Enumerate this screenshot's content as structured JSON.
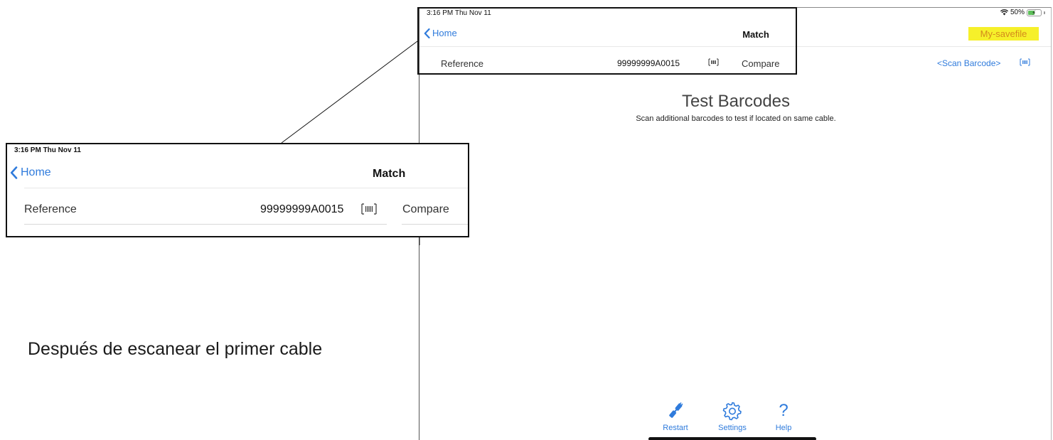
{
  "status_bar": {
    "time_date": "3:16 PM  Thu Nov 11",
    "battery": "50%",
    "battery_level": 0.5
  },
  "nav": {
    "back_label": "Home",
    "title": "Match",
    "savefile": "My-savefile"
  },
  "reference_row": {
    "label": "Reference",
    "value": "99999999A0015",
    "compare_label": "Compare",
    "scan_label": "<Scan Barcode>"
  },
  "main": {
    "heading": "Test Barcodes",
    "subtext": "Scan additional barcodes to test if located on same cable."
  },
  "toolbar": {
    "restart": "Restart",
    "settings": "Settings",
    "help": "Help",
    "help_glyph": "?"
  },
  "zoom_inset": {
    "time_date": "3:16 PM  Thu Nov 11",
    "back_label": "Home",
    "title": "Match",
    "ref_label": "Reference",
    "ref_value": "99999999A0015",
    "compare_label": "Compare"
  },
  "annotation": {
    "caption": "Después de escanear el primer cable"
  },
  "colors": {
    "accent": "#2f7bdc",
    "savefile_bg": "#f6f02a",
    "savefile_text": "#d48a1c",
    "battery_fill": "#5ec05a"
  },
  "icons": {
    "back": "chevron-left-icon",
    "barcode": "barcode-icon",
    "restart": "cable-plug-icon",
    "settings": "gear-icon",
    "help": "question-mark-icon",
    "wifi": "wifi-icon",
    "battery": "battery-charging-icon"
  }
}
